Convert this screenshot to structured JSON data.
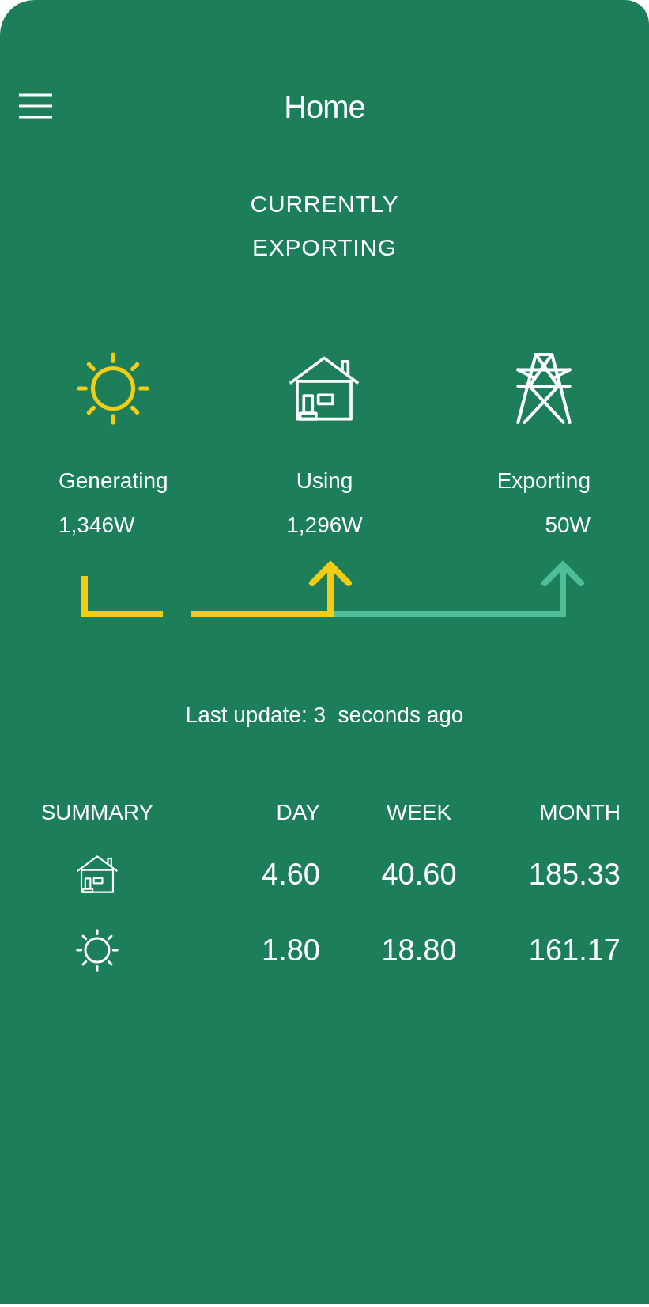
{
  "header": {
    "title": "Home"
  },
  "status": {
    "lines": [
      "CURRENTLY",
      "EXPORTING"
    ]
  },
  "flow": [
    {
      "kind": "sun",
      "label": "Generating",
      "value": "1,346W"
    },
    {
      "kind": "home",
      "label": "Using",
      "value": "1,296W"
    },
    {
      "kind": "grid",
      "label": "Exporting",
      "value": "50W"
    }
  ],
  "last_update": "Last update: 3  seconds ago",
  "summary": {
    "columns": [
      "SUMMARY",
      "DAY",
      "WEEK",
      "MONTH"
    ],
    "rows": [
      {
        "kind": "home",
        "values": [
          "4.60",
          "40.60",
          "185.33"
        ]
      },
      {
        "kind": "sun",
        "values": [
          "1.80",
          "18.80",
          "161.17"
        ]
      }
    ]
  }
}
